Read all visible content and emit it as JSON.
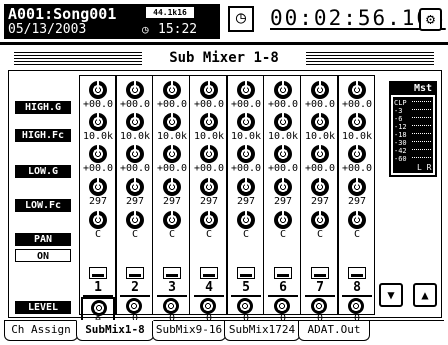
{
  "header": {
    "song_name": "A001:Song001",
    "date": "05/13/2003",
    "rate_badge": "44.1k16",
    "sys_time_icon": "clock-icon",
    "sys_time": "15:22",
    "counter": "00:02:56.105",
    "counter_icon": "clock-icon",
    "settings_icon": "gear-icon"
  },
  "panel": {
    "title": "Sub Mixer 1-8"
  },
  "rows": {
    "high_g": "HIGH.G",
    "high_fc": "HIGH.Fc",
    "low_g": "LOW.G",
    "low_fc": "LOW.Fc",
    "pan": "PAN",
    "on": "ON",
    "level": "LEVEL"
  },
  "channels": [
    {
      "num": "1",
      "high_g": "+00.0",
      "high_fc": "10.0k",
      "low_g": "+00.0",
      "low_fc": "297",
      "pan": "C",
      "level": "0"
    },
    {
      "num": "2",
      "high_g": "+00.0",
      "high_fc": "10.0k",
      "low_g": "+00.0",
      "low_fc": "297",
      "pan": "C",
      "level": "0"
    },
    {
      "num": "3",
      "high_g": "+00.0",
      "high_fc": "10.0k",
      "low_g": "+00.0",
      "low_fc": "297",
      "pan": "C",
      "level": "0"
    },
    {
      "num": "4",
      "high_g": "+00.0",
      "high_fc": "10.0k",
      "low_g": "+00.0",
      "low_fc": "297",
      "pan": "C",
      "level": "0"
    },
    {
      "num": "5",
      "high_g": "+00.0",
      "high_fc": "10.0k",
      "low_g": "+00.0",
      "low_fc": "297",
      "pan": "C",
      "level": "0"
    },
    {
      "num": "6",
      "high_g": "+00.0",
      "high_fc": "10.0k",
      "low_g": "+00.0",
      "low_fc": "297",
      "pan": "C",
      "level": "0"
    },
    {
      "num": "7",
      "high_g": "+00.0",
      "high_fc": "10.0k",
      "low_g": "+00.0",
      "low_fc": "297",
      "pan": "C",
      "level": "0"
    },
    {
      "num": "8",
      "high_g": "+00.0",
      "high_fc": "10.0k",
      "low_g": "+00.0",
      "low_fc": "297",
      "pan": "C",
      "level": "0"
    }
  ],
  "master": {
    "title": "Mst",
    "marks": [
      "CLP",
      "-3",
      "-6",
      "-12",
      "-18",
      "-30",
      "-42",
      "-60"
    ],
    "lr": "L R"
  },
  "nav": {
    "down_icon": "arrow-down-icon",
    "up_icon": "arrow-up-icon"
  },
  "tabs": [
    {
      "label": "Ch Assign",
      "active": false
    },
    {
      "label": "SubMix1-8",
      "active": true
    },
    {
      "label": "SubMix9-16",
      "active": false
    },
    {
      "label": "SubMix1724",
      "active": false
    },
    {
      "label": "ADAT.Out",
      "active": false
    }
  ]
}
